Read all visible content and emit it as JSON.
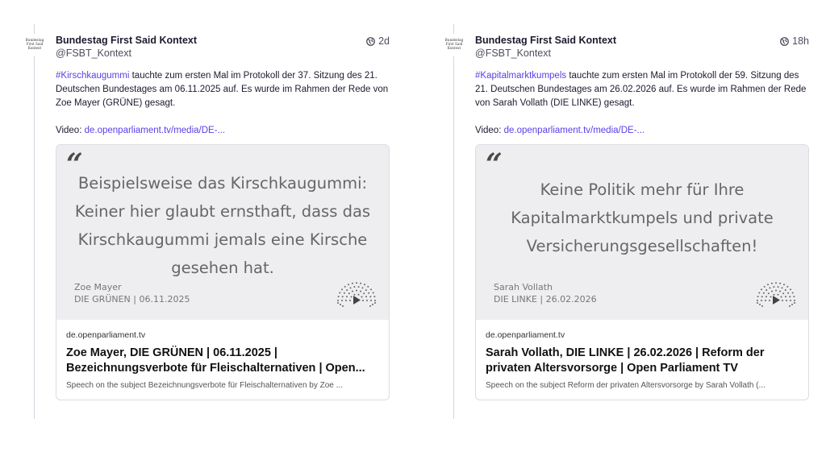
{
  "posts": [
    {
      "avatar_text": "Bundestag First Said Kontext",
      "display_name": "Bundestag First Said Kontext",
      "handle": "@FSBT_Kontext",
      "time": "2d",
      "hashtag": "#Kirschkaugummi",
      "text_rest": " tauchte zum ersten Mal im Protokoll der 37. Sitzung des 21. Deutschen Bundestages am 06.11.2025 auf. Es wurde im Rahmen der Rede von Zoe Mayer (GRÜNE) gesagt.",
      "video_label": "Video: ",
      "video_link": "de.openparliament.tv/media/DE-...",
      "card": {
        "quote_mark": "“",
        "quote": "Beispielsweise das Kirschkaugummi: Keiner hier glaubt ernsthaft, dass das Kirschkaugummi jemals eine Kirsche gesehen hat.",
        "speaker_name": "Zoe Mayer",
        "speaker_info": "DIE GRÜNEN | 06.11.2025",
        "domain": "de.openparliament.tv",
        "title": "Zoe Mayer, DIE GRÜNEN | 06.11.2025 | Bezeichnungsverbote für Fleischalternativen | Open...",
        "description": "Speech on the subject Bezeichnungsverbote für Fleischalternativen by Zoe ..."
      }
    },
    {
      "avatar_text": "Bundestag First Said Kontext",
      "display_name": "Bundestag First Said Kontext",
      "handle": "@FSBT_Kontext",
      "time": "18h",
      "hashtag": "#Kapitalmarktkumpels",
      "text_rest": " tauchte zum ersten Mal im Protokoll der 59. Sitzung des 21. Deutschen Bundestages am 26.02.2026 auf. Es wurde im Rahmen der Rede von Sarah Vollath (DIE LINKE) gesagt.",
      "video_label": "Video: ",
      "video_link": "de.openparliament.tv/media/DE-...",
      "card": {
        "quote_mark": "“",
        "quote": "Keine Politik mehr für Ihre Kapitalmarktkumpels und private Versicherungsgesellschaften!",
        "speaker_name": "Sarah Vollath",
        "speaker_info": "DIE LINKE | 26.02.2026",
        "domain": "de.openparliament.tv",
        "title": "Sarah Vollath, DIE LINKE | 26.02.2026 | Reform der privaten Altersvorsorge | Open Parliament TV",
        "description": "Speech on the subject Reform der privaten Altersvorsorge by Sarah Vollath (..."
      }
    }
  ],
  "colors": {
    "accent": "#5a3ee8",
    "quote_bg": "#eeeef0",
    "border": "#dcdce4"
  }
}
